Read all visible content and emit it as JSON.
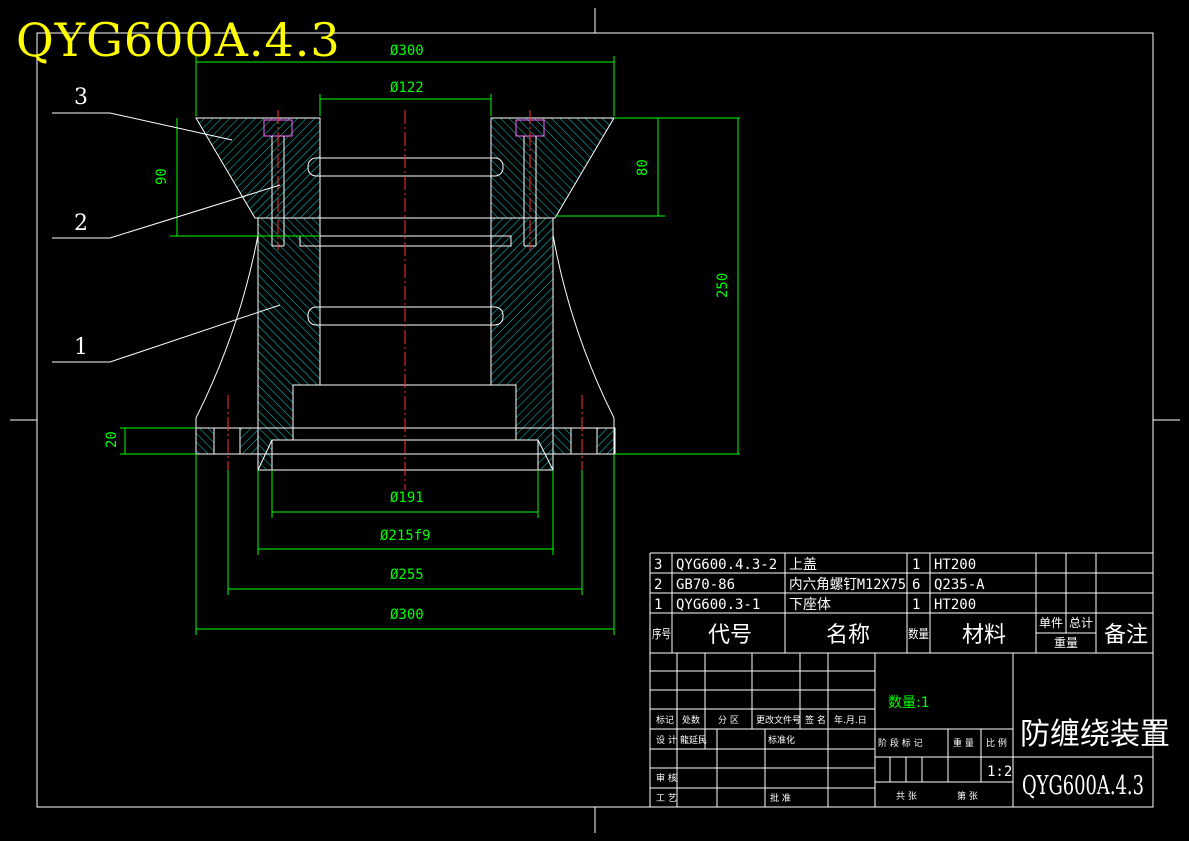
{
  "header": {
    "title": "QYG600A.4.3"
  },
  "dimensions": {
    "d300_top": "Ø300",
    "d122": "Ø122",
    "h90": "90",
    "h80": "80",
    "h250": "250",
    "h20": "20",
    "d191": "Ø191",
    "d215": "Ø215f9",
    "d255": "Ø255",
    "d300_bottom": "Ø300"
  },
  "leaders": [
    "3",
    "2",
    "1"
  ],
  "bom": {
    "rows": [
      {
        "no": "3",
        "code": "QYG600.4.3-2",
        "name": "上盖",
        "qty": "1",
        "material": "HT200"
      },
      {
        "no": "2",
        "code": "GB70-86",
        "name": "内六角螺钉M12X75",
        "qty": "6",
        "material": "Q235-A"
      },
      {
        "no": "1",
        "code": "QYG600.3-1",
        "name": "下座体",
        "qty": "1",
        "material": "HT200"
      }
    ],
    "header": {
      "no": "序号",
      "code": "代号",
      "name": "名称",
      "qty": "数量",
      "material": "材料",
      "unit_weight": "单件",
      "total_weight": "总计",
      "weight": "重量",
      "remark": "备注"
    }
  },
  "title_block": {
    "quantity": "数量:1",
    "part_name": "防缠绕装置",
    "drawing_no": "QYG600A.4.3",
    "scale": "1:2",
    "labels": {
      "mark": "标记",
      "count": "处数",
      "zone": "分 区",
      "change_doc": "更改文件号",
      "sign": "签 名",
      "date": "年.月.日",
      "design": "设 计",
      "designer": "龍延民",
      "standardize": "标准化",
      "review": "审 核",
      "process": "工 艺",
      "approve": "批 准",
      "stage_mark": "阶 段 标 记",
      "weight": "重 量",
      "ratio": "比 例",
      "sheets_total": "共    张",
      "sheet_no": "第    张"
    }
  },
  "colors": {
    "background": "#000000",
    "outline": "#ffffff",
    "dimension": "#00ff00",
    "hatch": "#00ffff",
    "centerline": "#ff0000",
    "title": "#ffff00",
    "bolt": "#ff00ff"
  }
}
